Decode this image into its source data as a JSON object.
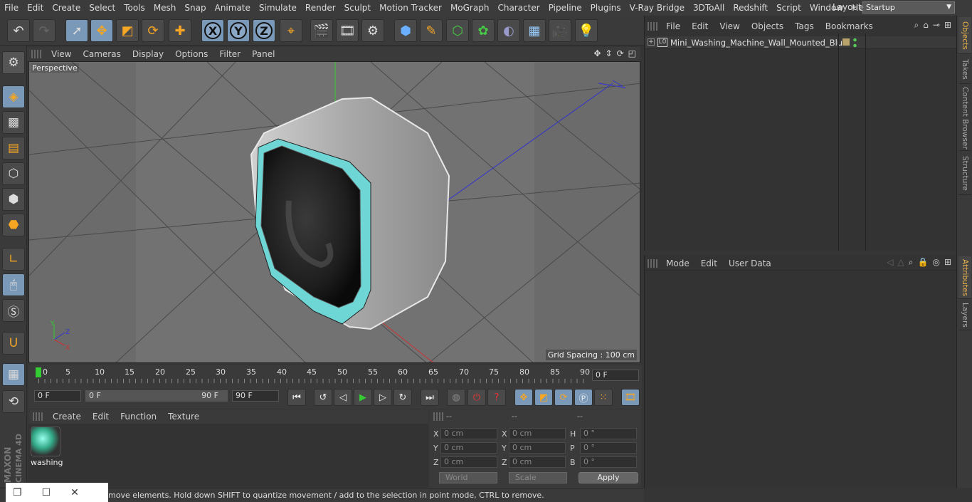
{
  "menubar": {
    "items": [
      "File",
      "Edit",
      "Create",
      "Select",
      "Tools",
      "Mesh",
      "Snap",
      "Animate",
      "Simulate",
      "Render",
      "Sculpt",
      "Motion Tracker",
      "MoGraph",
      "Character",
      "Pipeline",
      "Plugins",
      "V-Ray Bridge",
      "3DToAll",
      "Redshift",
      "Script",
      "Window",
      "Help"
    ],
    "layout_label": "Layout:",
    "layout_value": "Startup"
  },
  "toolbar": {
    "icons": [
      "undo-icon",
      "redo-icon",
      "live-select-icon",
      "move-icon",
      "scale-icon",
      "rotate-icon",
      "add-move-icon",
      "x-axis-lock",
      "y-axis-lock",
      "z-axis-lock",
      "world-coords-icon",
      "render-view-icon",
      "render-picture-queue-icon",
      "render-settings-icon",
      "cube-icon",
      "pen-icon",
      "subdivision-icon",
      "mograph-cloner-icon",
      "deformer-icon",
      "floor-icon",
      "camera-icon",
      "light-icon"
    ],
    "x_label": "X",
    "y_label": "Y",
    "z_label": "Z"
  },
  "viewport": {
    "menu": [
      "View",
      "Cameras",
      "Display",
      "Options",
      "Filter",
      "Panel"
    ],
    "label": "Perspective",
    "grid_spacing": "Grid Spacing : 100 cm"
  },
  "timeline": {
    "ticks": [
      "0",
      "5",
      "10",
      "15",
      "20",
      "25",
      "30",
      "35",
      "40",
      "45",
      "50",
      "55",
      "60",
      "65",
      "70",
      "75",
      "80",
      "85",
      "90"
    ],
    "current_frame": "0 F"
  },
  "transport": {
    "start_field": "0 F",
    "range_start": "0 F",
    "range_end": "90 F",
    "end_field": "90 F"
  },
  "material": {
    "menu": [
      "Create",
      "Edit",
      "Function",
      "Texture"
    ],
    "name": "washing"
  },
  "coords": {
    "headers": [
      "--",
      "--",
      "--"
    ],
    "rows": [
      {
        "a": "X",
        "av": "0 cm",
        "b": "X",
        "bv": "0 cm",
        "c": "H",
        "cv": "0 °"
      },
      {
        "a": "Y",
        "av": "0 cm",
        "b": "Y",
        "bv": "0 cm",
        "c": "P",
        "cv": "0 °"
      },
      {
        "a": "Z",
        "av": "0 cm",
        "b": "Z",
        "bv": "0 cm",
        "c": "B",
        "cv": "0 °"
      }
    ],
    "world": "World",
    "scale": "Scale",
    "apply": "Apply"
  },
  "status": "move elements. Hold down SHIFT to quantize movement / add to the selection in point mode, CTRL to remove.",
  "objects": {
    "menu": [
      "File",
      "Edit",
      "View",
      "Objects",
      "Tags",
      "Bookmarks"
    ],
    "item": "Mini_Washing_Machine_Wall_Mounted_Blue"
  },
  "attributes": {
    "menu": [
      "Mode",
      "Edit",
      "User Data"
    ]
  },
  "right_tabs": [
    "Objects",
    "Takes",
    "Content Browser",
    "Structure",
    "Attributes",
    "Layers"
  ],
  "brand": {
    "maxon": "MAXON",
    "cinema": "CINEMA 4D"
  },
  "colors": {
    "selected": "#7a98b8",
    "accent_tab": "#e8b24a",
    "machine_trim": "#6fd6d6"
  }
}
